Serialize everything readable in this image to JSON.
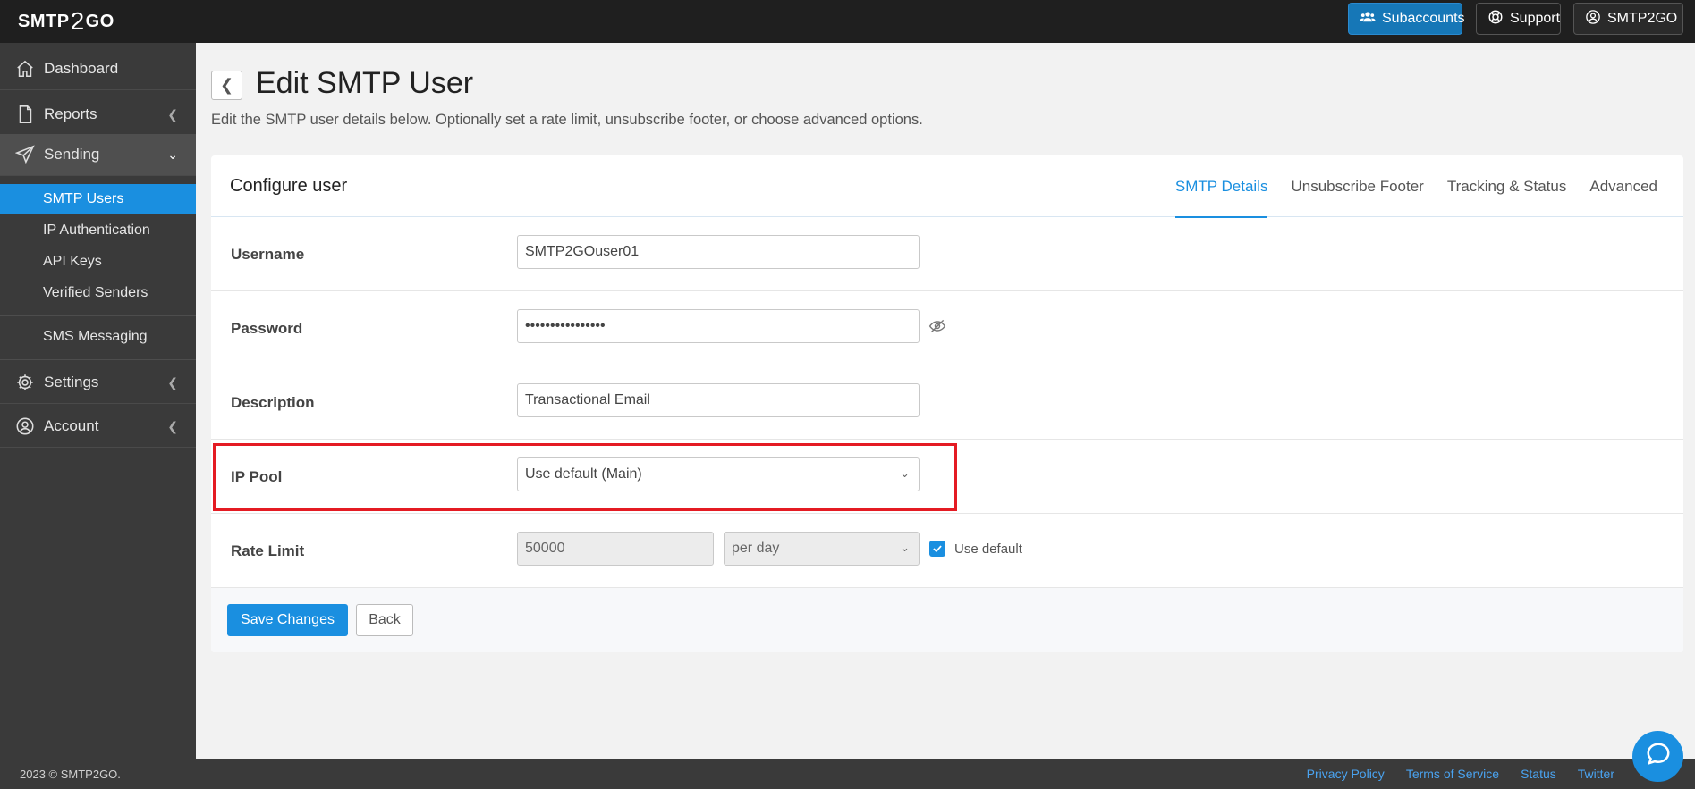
{
  "brand": {
    "left": "SMTP",
    "mid": "2",
    "right": "GO"
  },
  "topbar": {
    "subaccounts_label": "Subaccounts",
    "support_label": "Support",
    "account_label": "SMTP2GO"
  },
  "sidebar": {
    "dashboard": "Dashboard",
    "reports": "Reports",
    "sending": "Sending",
    "sub_items": [
      "SMTP Users",
      "IP Authentication",
      "API Keys",
      "Verified Senders"
    ],
    "sms": "SMS Messaging",
    "settings": "Settings",
    "account": "Account"
  },
  "page": {
    "title": "Edit SMTP User",
    "description": "Edit the SMTP user details below. Optionally set a rate limit, unsubscribe footer, or choose advanced options."
  },
  "card": {
    "title": "Configure user",
    "tabs": [
      "SMTP Details",
      "Unsubscribe Footer",
      "Tracking & Status",
      "Advanced"
    ],
    "active_tab": "SMTP Details"
  },
  "form": {
    "username": {
      "label": "Username",
      "value": "SMTP2GOuser01"
    },
    "password": {
      "label": "Password",
      "value": "••••••••••••••••"
    },
    "description": {
      "label": "Description",
      "value": "Transactional Email"
    },
    "ip_pool": {
      "label": "IP Pool",
      "value": "Use default (Main)"
    },
    "rate_limit": {
      "label": "Rate Limit",
      "value": "50000",
      "period": "per day",
      "use_default_label": "Use default",
      "use_default_checked": true
    }
  },
  "actions": {
    "save_label": "Save Changes",
    "back_label": "Back"
  },
  "footer": {
    "copyright": "2023 © SMTP2GO.",
    "links": [
      "Privacy Policy",
      "Terms of Service",
      "Status",
      "Twitter"
    ]
  },
  "colors": {
    "accent": "#1a8fe0",
    "topbar": "#1f1f1f",
    "sidebar": "#3a3a3a",
    "highlight": "#e41b23"
  }
}
